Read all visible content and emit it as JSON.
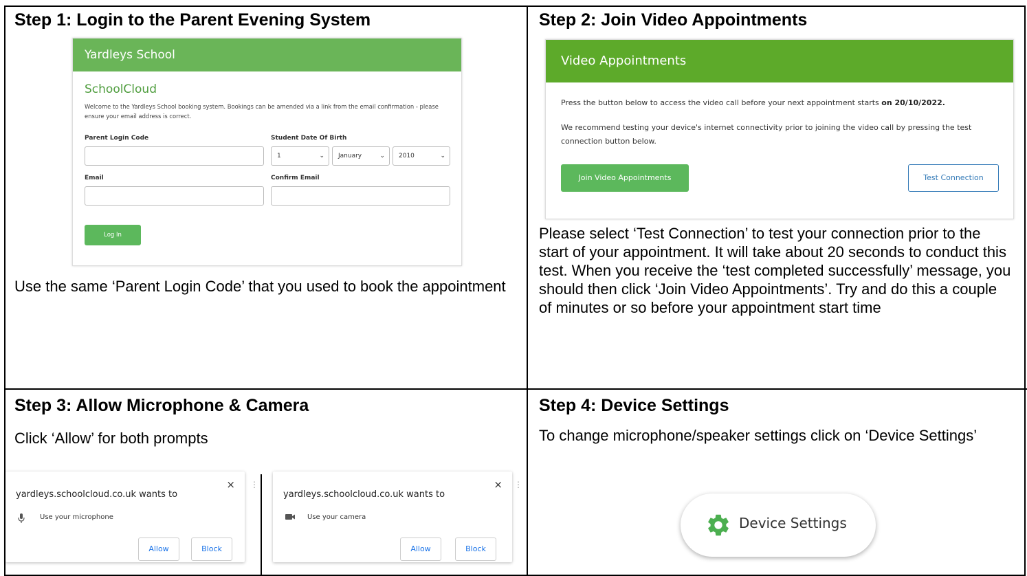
{
  "step1": {
    "title": "Step 1: Login to the Parent Evening System",
    "card": {
      "header": "Yardleys School",
      "app_title": "SchoolCloud",
      "welcome": "Welcome to the Yardleys School booking system. Bookings can be amended via a link from the email confirmation - please ensure your email address is correct.",
      "parent_login_label": "Parent Login Code",
      "dob_label": "Student Date Of Birth",
      "dob_day": "1",
      "dob_month": "January",
      "dob_year": "2010",
      "email_label": "Email",
      "confirm_email_label": "Confirm Email",
      "login_button": "Log In"
    },
    "caption": "Use the same ‘Parent Login Code’ that you used to book the appointment"
  },
  "step2": {
    "title": "Step 2: Join Video Appointments",
    "card": {
      "header": "Video Appointments",
      "line1": "Press the button below to access the video call before your next appointment starts",
      "line1_date": "on 20/10/2022.",
      "line2": "We recommend testing your device's internet connectivity prior to joining the video call by pressing the test connection button below.",
      "join_button": "Join Video Appointments",
      "test_button": "Test Connection"
    },
    "caption": "Please select ‘Test Connection’ to test your connection prior to the start of your appointment. It will take about 20 seconds to conduct this test. When you receive the ‘test completed successfully’ message, you should then click ‘Join Video Appointments’. Try and do this a couple of minutes or so before your appointment start time"
  },
  "step3": {
    "title": "Step 3: Allow Microphone & Camera",
    "caption": "Click ‘Allow’ for both prompts",
    "popups": [
      {
        "site": "yardleys.schoolcloud.co.uk wants to",
        "icon": "microphone-icon",
        "permission": "Use your microphone",
        "allow": "Allow",
        "block": "Block",
        "close": "×"
      },
      {
        "site": "yardleys.schoolcloud.co.uk wants to",
        "icon": "camera-icon",
        "permission": "Use your camera",
        "allow": "Allow",
        "block": "Block",
        "close": "×"
      }
    ]
  },
  "step4": {
    "title": "Step 4: Device Settings",
    "caption": "To change microphone/speaker settings click on ‘Device Settings’",
    "button": "Device Settings",
    "icon": "gear-icon"
  },
  "colors": {
    "school_green": "#6ab558",
    "video_green": "#5daa2a",
    "button_green": "#5cb85c",
    "link_blue": "#337ab7",
    "gear_green": "#4caf50"
  }
}
